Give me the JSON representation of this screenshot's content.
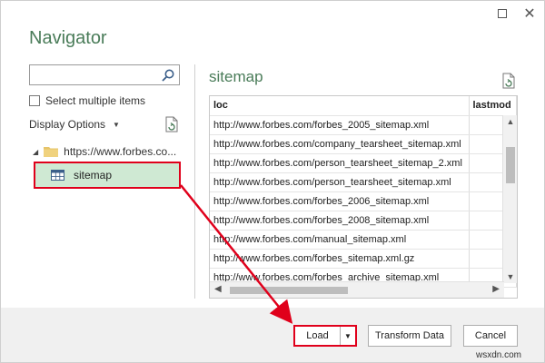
{
  "dialog": {
    "title": "Navigator",
    "maximize_icon": "maximize-icon",
    "close_icon": "close-icon"
  },
  "left_pane": {
    "search": {
      "value": "",
      "placeholder": ""
    },
    "select_multiple_label": "Select multiple items",
    "display_options_label": "Display Options",
    "tree": {
      "folder_label": "https://www.forbes.co...",
      "items": [
        {
          "label": "sitemap",
          "selected": true
        }
      ]
    }
  },
  "right_pane": {
    "title": "sitemap",
    "columns": [
      "loc",
      "lastmod"
    ],
    "rows": [
      [
        "http://www.forbes.com/forbes_2005_sitemap.xml",
        ""
      ],
      [
        "http://www.forbes.com/company_tearsheet_sitemap.xml",
        ""
      ],
      [
        "http://www.forbes.com/person_tearsheet_sitemap_2.xml",
        ""
      ],
      [
        "http://www.forbes.com/person_tearsheet_sitemap.xml",
        ""
      ],
      [
        "http://www.forbes.com/forbes_2006_sitemap.xml",
        ""
      ],
      [
        "http://www.forbes.com/forbes_2008_sitemap.xml",
        ""
      ],
      [
        "http://www.forbes.com/manual_sitemap.xml",
        ""
      ],
      [
        "http://www.forbes.com/forbes_sitemap.xml.gz",
        ""
      ],
      [
        "http://www.forbes.com/forbes_archive_sitemap.xml",
        ""
      ]
    ]
  },
  "footer": {
    "load_label": "Load",
    "transform_label": "Transform Data",
    "cancel_label": "Cancel"
  },
  "annotation": {
    "color": "#e0001b"
  },
  "watermark": "wsxdn.com",
  "colors": {
    "accent": "#4a7c59",
    "selection": "#cfe9d3"
  }
}
